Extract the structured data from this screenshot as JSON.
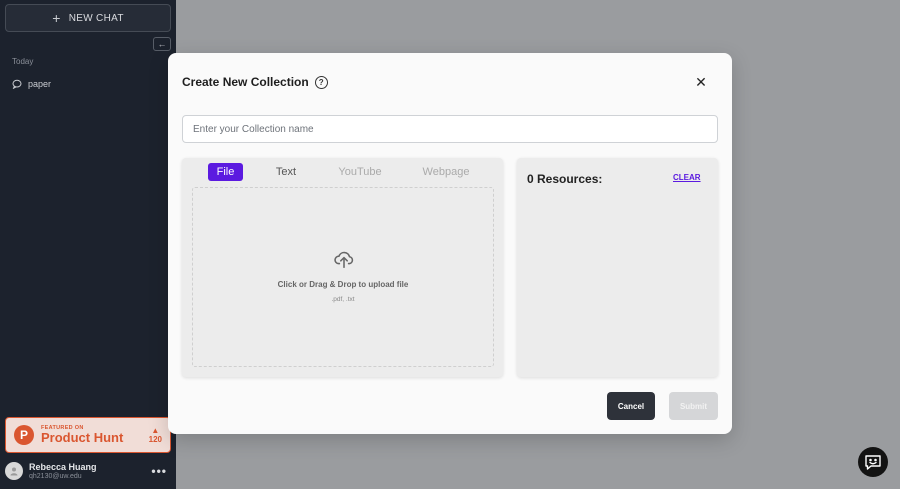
{
  "sidebar": {
    "new_chat_label": "NEW CHAT",
    "collapse_glyph": "←",
    "section_today": "Today",
    "chats": [
      {
        "label": "paper"
      }
    ],
    "product_hunt": {
      "featured": "FEATURED ON",
      "name": "Product Hunt",
      "votes": "120"
    },
    "user": {
      "name": "Rebecca Huang",
      "email": "qh2130@uw.edu"
    }
  },
  "modal": {
    "title": "Create New Collection",
    "name_placeholder": "Enter your Collection name",
    "tabs": [
      {
        "label": "File"
      },
      {
        "label": "Text"
      },
      {
        "label": "YouTube"
      },
      {
        "label": "Webpage"
      }
    ],
    "upload_text": "Click or Drag & Drop to upload file",
    "upload_types": ".pdf, .txt",
    "resources_title": "0 Resources:",
    "clear_label": "CLEAR",
    "cancel_label": "Cancel",
    "submit_label": "Submit"
  },
  "colors": {
    "accent": "#5b1ae0",
    "sidebar_bg": "#1c222d",
    "product_hunt": "#da5630"
  }
}
